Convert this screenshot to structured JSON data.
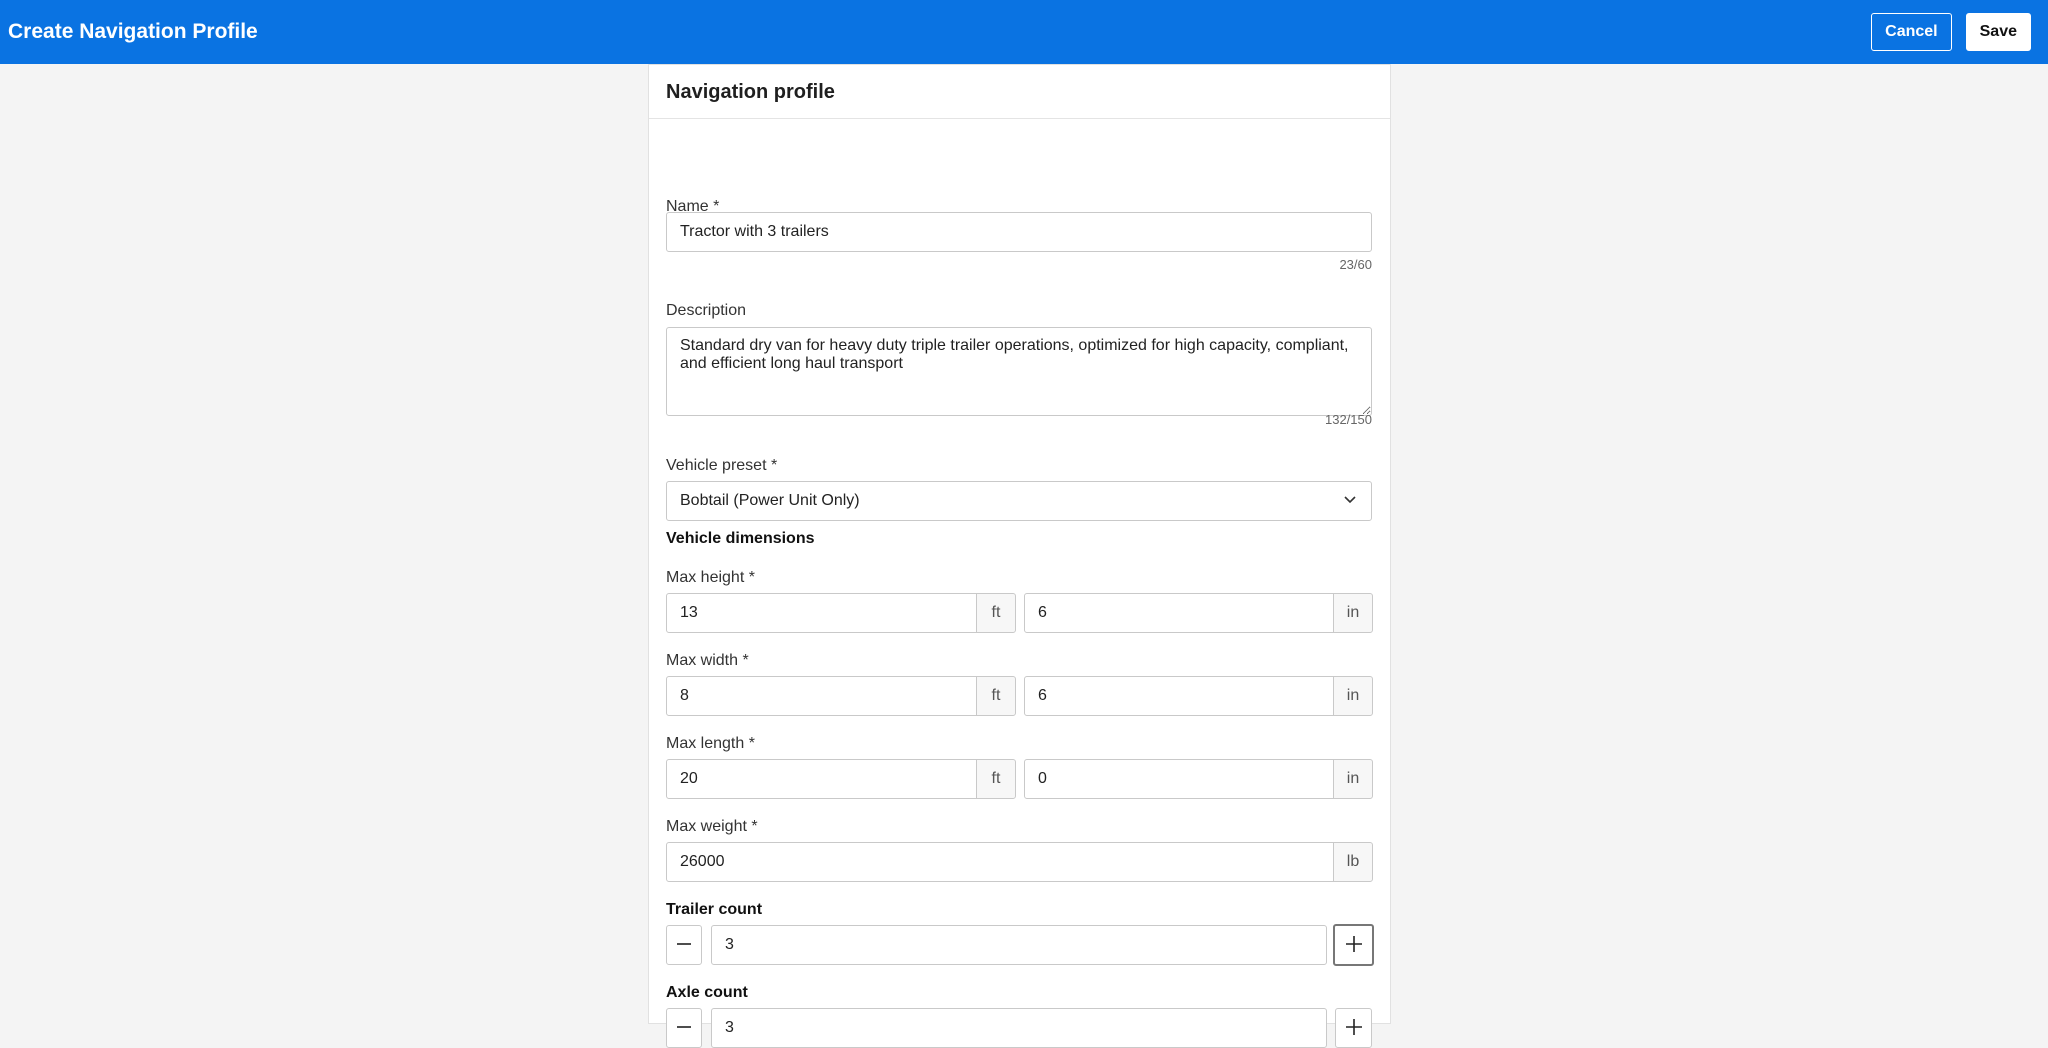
{
  "header": {
    "title": "Create Navigation Profile",
    "cancel_label": "Cancel",
    "save_label": "Save"
  },
  "card": {
    "title": "Navigation profile"
  },
  "form": {
    "name": {
      "label": "Name *",
      "value": "Tractor with 3 trailers",
      "counter": "23/60"
    },
    "description": {
      "label": "Description",
      "value": "Standard dry van for heavy duty triple trailer operations, optimized for high capacity, compliant, and efficient long haul transport",
      "counter": "132/150"
    },
    "vehicle_preset": {
      "label": "Vehicle preset *",
      "value": "Bobtail (Power Unit Only)"
    },
    "dimensions_title": "Vehicle dimensions",
    "max_height": {
      "label": "Max height *",
      "ft": "13",
      "ft_unit": "ft",
      "in": "6",
      "in_unit": "in"
    },
    "max_width": {
      "label": "Max width *",
      "ft": "8",
      "ft_unit": "ft",
      "in": "6",
      "in_unit": "in"
    },
    "max_length": {
      "label": "Max length *",
      "ft": "20",
      "ft_unit": "ft",
      "in": "0",
      "in_unit": "in"
    },
    "max_weight": {
      "label": "Max weight *",
      "value": "26000",
      "unit": "lb"
    },
    "trailer_count": {
      "label": "Trailer count",
      "value": "3"
    },
    "axle_count": {
      "label": "Axle count",
      "value": "3"
    }
  },
  "icons": {
    "minus": "minus-icon",
    "plus": "plus-icon",
    "chevron": "chevron-down-icon"
  }
}
